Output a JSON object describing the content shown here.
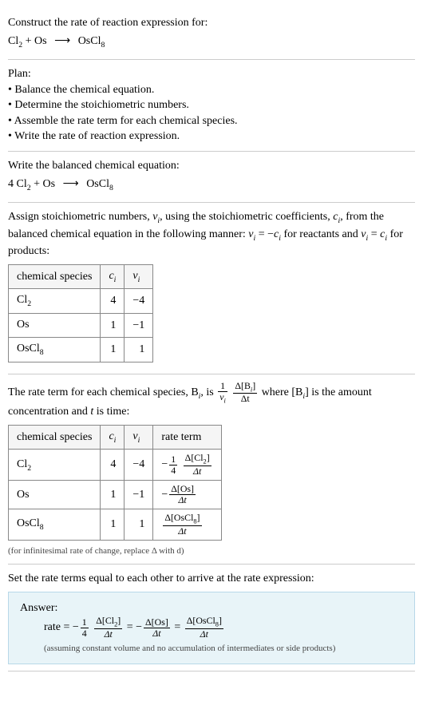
{
  "header": {
    "prompt": "Construct the rate of reaction expression for:",
    "eq_lhs1": "Cl",
    "eq_lhs1_sub": "2",
    "plus": " + ",
    "eq_lhs2": "Os",
    "arrow": "⟶",
    "eq_rhs": "OsCl",
    "eq_rhs_sub": "8"
  },
  "plan": {
    "title": "Plan:",
    "items": [
      "Balance the chemical equation.",
      "Determine the stoichiometric numbers.",
      "Assemble the rate term for each chemical species.",
      "Write the rate of reaction expression."
    ]
  },
  "balanced": {
    "intro": "Write the balanced chemical equation:",
    "coef1": "4 ",
    "sp1": "Cl",
    "sp1_sub": "2",
    "plus": " + ",
    "sp2": "Os",
    "arrow": "⟶",
    "sp3": "OsCl",
    "sp3_sub": "8"
  },
  "assign": {
    "text_a": "Assign stoichiometric numbers, ",
    "nu": "ν",
    "nu_sub": "i",
    "text_b": ", using the stoichiometric coefficients, ",
    "c": "c",
    "c_sub": "i",
    "text_c": ", from the balanced chemical equation in the following manner: ",
    "rel1_a": "ν",
    "rel1_a_sub": "i",
    "rel1_eq": " = −",
    "rel1_b": "c",
    "rel1_b_sub": "i",
    "text_d": " for reactants and ",
    "rel2_a": "ν",
    "rel2_a_sub": "i",
    "rel2_eq": " = ",
    "rel2_b": "c",
    "rel2_b_sub": "i",
    "text_e": " for products:"
  },
  "table1": {
    "headers": {
      "h1": "chemical species",
      "h2": "c",
      "h2_sub": "i",
      "h3": "ν",
      "h3_sub": "i"
    },
    "rows": [
      {
        "sp": "Cl",
        "sp_sub": "2",
        "c": "4",
        "nu": "−4"
      },
      {
        "sp": "Os",
        "sp_sub": "",
        "c": "1",
        "nu": "−1"
      },
      {
        "sp": "OsCl",
        "sp_sub": "8",
        "c": "1",
        "nu": "1"
      }
    ]
  },
  "rateterm": {
    "text_a": "The rate term for each chemical species, B",
    "sub_i": "i",
    "text_b": ", is ",
    "frac1_num": "1",
    "frac1_den_a": "ν",
    "frac1_den_sub": "i",
    "frac2_num_a": "Δ[B",
    "frac2_num_sub": "i",
    "frac2_num_b": "]",
    "frac2_den": "Δt",
    "text_c": " where [B",
    "text_d": "] is the amount concentration and ",
    "t": "t",
    "text_e": " is time:"
  },
  "table2": {
    "headers": {
      "h1": "chemical species",
      "h2": "c",
      "h2_sub": "i",
      "h3": "ν",
      "h3_sub": "i",
      "h4": "rate term"
    },
    "rows": [
      {
        "sp": "Cl",
        "sp_sub": "2",
        "c": "4",
        "nu": "−4",
        "rt_neg": "−",
        "rt_f1_num": "1",
        "rt_f1_den": "4",
        "rt_f2_num": "Δ[Cl",
        "rt_f2_num_sub": "2",
        "rt_f2_num_b": "]",
        "rt_f2_den": "Δt"
      },
      {
        "sp": "Os",
        "sp_sub": "",
        "c": "1",
        "nu": "−1",
        "rt_neg": "−",
        "rt_f1_num": "",
        "rt_f1_den": "",
        "rt_f2_num": "Δ[Os]",
        "rt_f2_num_sub": "",
        "rt_f2_num_b": "",
        "rt_f2_den": "Δt"
      },
      {
        "sp": "OsCl",
        "sp_sub": "8",
        "c": "1",
        "nu": "1",
        "rt_neg": "",
        "rt_f1_num": "",
        "rt_f1_den": "",
        "rt_f2_num": "Δ[OsCl",
        "rt_f2_num_sub": "8",
        "rt_f2_num_b": "]",
        "rt_f2_den": "Δt"
      }
    ],
    "note": "(for infinitesimal rate of change, replace Δ with d)"
  },
  "final": {
    "intro": "Set the rate terms equal to each other to arrive at the rate expression:",
    "answer_label": "Answer:",
    "rate_label": "rate = ",
    "t1_neg": "−",
    "t1_f1_num": "1",
    "t1_f1_den": "4",
    "t1_f2_num": "Δ[Cl",
    "t1_f2_num_sub": "2",
    "t1_f2_num_b": "]",
    "t1_f2_den": "Δt",
    "eq1": " = ",
    "t2_neg": "−",
    "t2_f2_num": "Δ[Os]",
    "t2_f2_den": "Δt",
    "eq2": " = ",
    "t3_f2_num": "Δ[OsCl",
    "t3_f2_num_sub": "8",
    "t3_f2_num_b": "]",
    "t3_f2_den": "Δt",
    "note": "(assuming constant volume and no accumulation of intermediates or side products)"
  },
  "chart_data": {
    "type": "table",
    "tables": [
      {
        "title": "Stoichiometric numbers",
        "columns": [
          "chemical species",
          "c_i",
          "ν_i"
        ],
        "rows": [
          [
            "Cl2",
            4,
            -4
          ],
          [
            "Os",
            1,
            -1
          ],
          [
            "OsCl8",
            1,
            1
          ]
        ]
      },
      {
        "title": "Rate terms",
        "columns": [
          "chemical species",
          "c_i",
          "ν_i",
          "rate term"
        ],
        "rows": [
          [
            "Cl2",
            4,
            -4,
            "-(1/4) Δ[Cl2]/Δt"
          ],
          [
            "Os",
            1,
            -1,
            "-Δ[Os]/Δt"
          ],
          [
            "OsCl8",
            1,
            1,
            "Δ[OsCl8]/Δt"
          ]
        ]
      }
    ]
  }
}
